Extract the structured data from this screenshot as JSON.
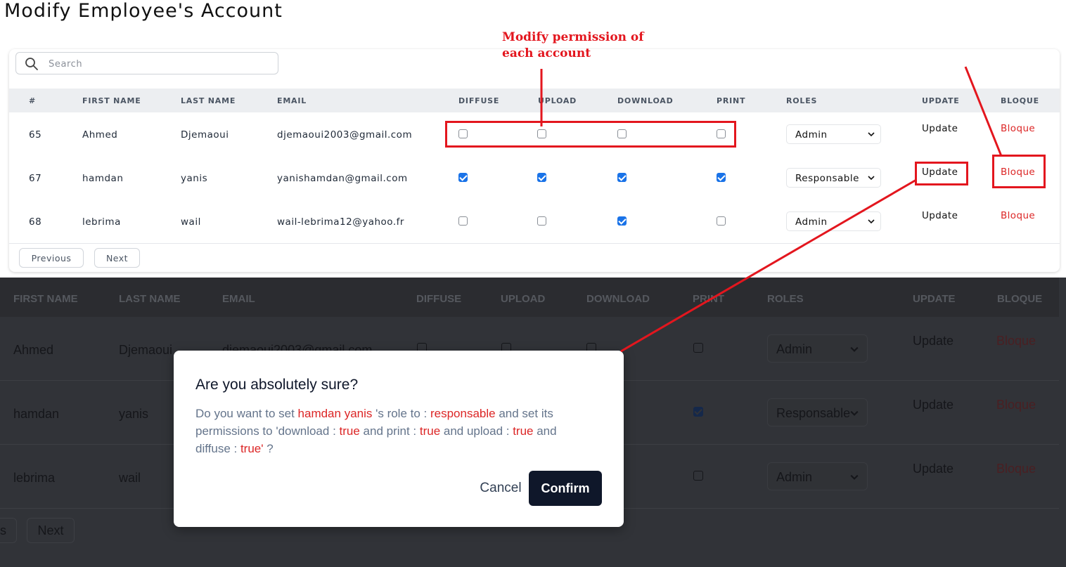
{
  "page_title": "Modify Employee's Account",
  "search": {
    "placeholder": "Search"
  },
  "table": {
    "headers": {
      "num": "#",
      "first": "FIRST NAME",
      "last": "LAST NAME",
      "email": "EMAIL",
      "diffuse": "DIFFUSE",
      "upload": "UPLOAD",
      "download": "DOWNLOAD",
      "print": "PRINT",
      "roles": "ROLES",
      "update": "UPDATE",
      "bloque": "BLOQUE"
    },
    "rows": [
      {
        "id": "65",
        "first": "Ahmed",
        "last": "Djemaoui",
        "email": "djemaoui2003@gmail.com",
        "diffuse": false,
        "upload": false,
        "download": false,
        "print": false,
        "role": "Admin",
        "update": "Update",
        "bloque": "Bloque"
      },
      {
        "id": "67",
        "first": "hamdan",
        "last": "yanis",
        "email": "yanishamdan@gmail.com",
        "diffuse": true,
        "upload": true,
        "download": true,
        "print": true,
        "role": "Responsable",
        "update": "Update",
        "bloque": "Bloque"
      },
      {
        "id": "68",
        "first": "lebrima",
        "last": "wail",
        "email": "wail-lebrima12@yahoo.fr",
        "diffuse": false,
        "upload": false,
        "download": true,
        "print": false,
        "role": "Admin",
        "update": "Update",
        "bloque": "Bloque"
      }
    ]
  },
  "pagination": {
    "previous": "Previous",
    "next": "Next"
  },
  "annotation": {
    "line1": "Modify permission of",
    "line2": "each account"
  },
  "dark_table": {
    "headers": {
      "first": "FIRST NAME",
      "last": "LAST NAME",
      "email": "EMAIL",
      "diffuse": "DIFFUSE",
      "upload": "UPLOAD",
      "download": "DOWNLOAD",
      "print": "PRINT",
      "roles": "ROLES",
      "update": "UPDATE",
      "bloque": "BLOQUE"
    },
    "rows": [
      {
        "first": "Ahmed",
        "last": "Djemaoui",
        "email": "djemaoui2003@gmail.com",
        "print": false,
        "role": "Admin",
        "update": "Update",
        "bloque": "Bloque"
      },
      {
        "first": "hamdan",
        "last": "yanis",
        "print": true,
        "role": "Responsable",
        "update": "Update",
        "bloque": "Bloque"
      },
      {
        "first": "lebrima",
        "last": "wail",
        "print": false,
        "role": "Admin",
        "update": "Update",
        "bloque": "Bloque"
      }
    ],
    "prev_partial": "s",
    "next": "Next"
  },
  "modal": {
    "title": "Are you absolutely sure?",
    "t1": "Do you want to set ",
    "name": "hamdan yanis",
    "t2": " 's role to : ",
    "role": "responsable",
    "t3": " and set its permissions to 'download : ",
    "v1": "true",
    "t4": " and print : ",
    "v2": "true",
    "t5": " and upload : ",
    "v3": "true",
    "t6": " and diffuse : ",
    "v4": "true'",
    "t7": " ?",
    "cancel": "Cancel",
    "confirm": "Confirm"
  },
  "colors": {
    "accent_red": "#e3161e",
    "checkbox_blue": "#1a73e8",
    "confirm_bg": "#0f172a",
    "bloque_red": "#dc2626"
  }
}
